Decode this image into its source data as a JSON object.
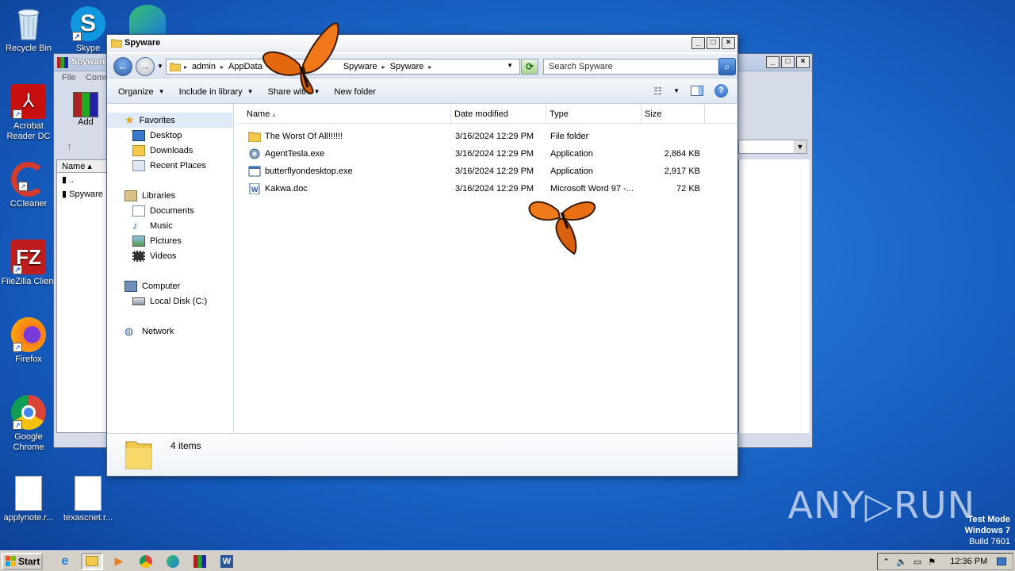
{
  "desktop": {
    "icons": [
      {
        "label": "Recycle Bin"
      },
      {
        "label": "Skype"
      },
      {
        "label": "Acrobat Reader DC"
      },
      {
        "label": "CCleaner"
      },
      {
        "label": "FileZilla Client"
      },
      {
        "label": "Firefox"
      },
      {
        "label": "Google Chrome"
      },
      {
        "label": "applynote.r..."
      },
      {
        "label": "texascnet.r..."
      }
    ]
  },
  "back_window": {
    "title": "Spyware",
    "menu": [
      "File",
      "Comm"
    ],
    "add_label": "Add",
    "name_col": "Name",
    "items": [
      "..",
      "Spyware"
    ]
  },
  "window": {
    "title": "Spyware",
    "breadcrumb": [
      "admin",
      "AppData",
      "Spyware",
      "Spyware"
    ],
    "search_placeholder": "Search Spyware",
    "toolbar": {
      "organize": "Organize",
      "include_library": "Include in library",
      "share_with": "Share with",
      "new_folder": "New folder"
    },
    "nav": {
      "favorites": "Favorites",
      "desktop": "Desktop",
      "downloads": "Downloads",
      "recent": "Recent Places",
      "libraries": "Libraries",
      "documents": "Documents",
      "music": "Music",
      "pictures": "Pictures",
      "videos": "Videos",
      "computer": "Computer",
      "local_disk": "Local Disk (C:)",
      "network": "Network"
    },
    "columns": {
      "name": "Name",
      "date": "Date modified",
      "type": "Type",
      "size": "Size"
    },
    "files": [
      {
        "name": "The Worst Of All!!!!!!",
        "date": "3/16/2024 12:29 PM",
        "type": "File folder",
        "size": "",
        "icon": "folder-icon"
      },
      {
        "name": "AgentTesla.exe",
        "date": "3/16/2024 12:29 PM",
        "type": "Application",
        "size": "2,864 KB",
        "icon": "exe-icon"
      },
      {
        "name": "butterflyondesktop.exe",
        "date": "3/16/2024 12:29 PM",
        "type": "Application",
        "size": "2,917 KB",
        "icon": "exe-icon"
      },
      {
        "name": "Kakwa.doc",
        "date": "3/16/2024 12:29 PM",
        "type": "Microsoft Word 97 -...",
        "size": "72 KB",
        "icon": "word-doc-icon"
      }
    ],
    "status": "4 items"
  },
  "taskbar": {
    "start": "Start",
    "clock": "12:36 PM"
  },
  "watermark": {
    "brand": "ANY▷RUN",
    "line1": "Test Mode",
    "line2": "Windows 7",
    "line3": "Build 7601"
  },
  "colors": {
    "desktop_blue": "#1f6fd0",
    "selection": "#dfe9f7",
    "taskbar": "#d4d0c8"
  }
}
